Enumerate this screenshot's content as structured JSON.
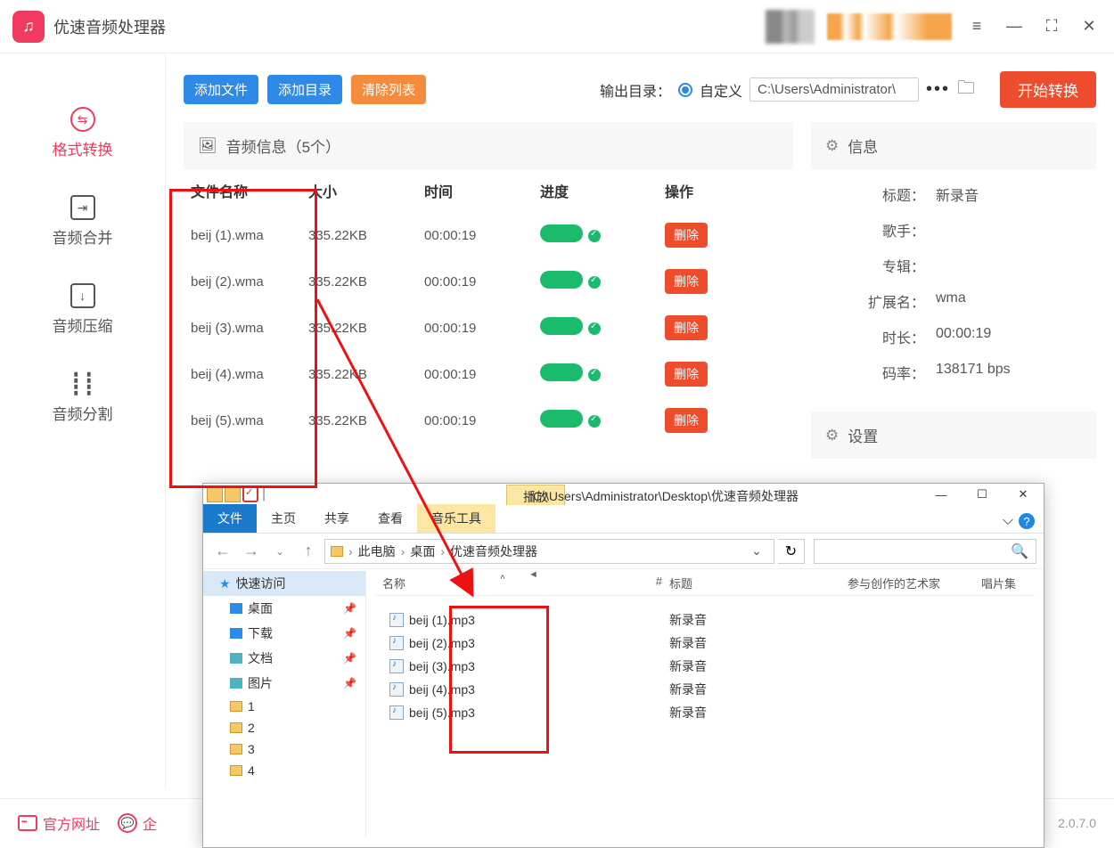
{
  "app": {
    "title": "优速音频处理器"
  },
  "titlebar_icons": {
    "menu": "≡",
    "min": "—",
    "full": "⛶",
    "close": "✕"
  },
  "sidebar": {
    "items": [
      {
        "label": "格式转换"
      },
      {
        "label": "音频合并"
      },
      {
        "label": "音频压缩"
      },
      {
        "label": "音频分割"
      }
    ]
  },
  "toolbar": {
    "add_file": "添加文件",
    "add_dir": "添加目录",
    "clear_list": "清除列表",
    "output_label": "输出目录：",
    "custom_label": "自定义",
    "path_value": "C:\\Users\\Administrator\\",
    "dots": "•••",
    "start_label": "开始转换"
  },
  "table": {
    "header_title": "音频信息（5个）",
    "cols": {
      "name": "文件名称",
      "size": "大小",
      "time": "时间",
      "progress": "进度",
      "op": "操作"
    },
    "delete_label": "删除",
    "rows": [
      {
        "name": "beij (1).wma",
        "size": "335.22KB",
        "time": "00:00:19"
      },
      {
        "name": "beij (2).wma",
        "size": "335.22KB",
        "time": "00:00:19"
      },
      {
        "name": "beij (3).wma",
        "size": "335.22KB",
        "time": "00:00:19"
      },
      {
        "name": "beij (4).wma",
        "size": "335.22KB",
        "time": "00:00:19"
      },
      {
        "name": "beij (5).wma",
        "size": "335.22KB",
        "time": "00:00:19"
      }
    ]
  },
  "info": {
    "panel_title": "信息",
    "labels": {
      "title": "标题：",
      "artist": "歌手：",
      "album": "专辑：",
      "ext": "扩展名：",
      "dur": "时长：",
      "rate": "码率："
    },
    "values": {
      "title": "新录音",
      "artist": "",
      "album": "",
      "ext": "wma",
      "dur": "00:00:19",
      "rate": "138171 bps"
    }
  },
  "settings": {
    "panel_title": "设置"
  },
  "footer": {
    "site": "官方网址",
    "chat": "企",
    "version": "2.0.7.0"
  },
  "explorer": {
    "tab_play": "播放",
    "path_title": "C:\\Users\\Administrator\\Desktop\\优速音频处理器",
    "win": {
      "min": "—",
      "max": "☐",
      "close": "✕"
    },
    "ribbon": {
      "file": "文件",
      "home": "主页",
      "share": "共享",
      "view": "查看",
      "music": "音乐工具"
    },
    "help_caret": "⌵",
    "nav": {
      "back": "←",
      "fwd": "→",
      "drop": "⌄",
      "up": "↑",
      "refresh": "↻",
      "search_icon": "🔍"
    },
    "crumbs": [
      "此电脑",
      "桌面",
      "优速音频处理器"
    ],
    "addr_drop": "⌄",
    "cols": {
      "name": "名称",
      "num": "#",
      "title": "标题",
      "artist": "参与创作的艺术家",
      "album": "唱片集"
    },
    "sort_caret": "˄",
    "side": {
      "quick": "快速访问",
      "items": [
        "桌面",
        "下载",
        "文档",
        "图片",
        "1",
        "2",
        "3",
        "4"
      ]
    },
    "rows": [
      {
        "name": "beij (1).mp3",
        "title": "新录音"
      },
      {
        "name": "beij (2).mp3",
        "title": "新录音"
      },
      {
        "name": "beij (3).mp3",
        "title": "新录音"
      },
      {
        "name": "beij (4).mp3",
        "title": "新录音"
      },
      {
        "name": "beij (5).mp3",
        "title": "新录音"
      }
    ]
  }
}
